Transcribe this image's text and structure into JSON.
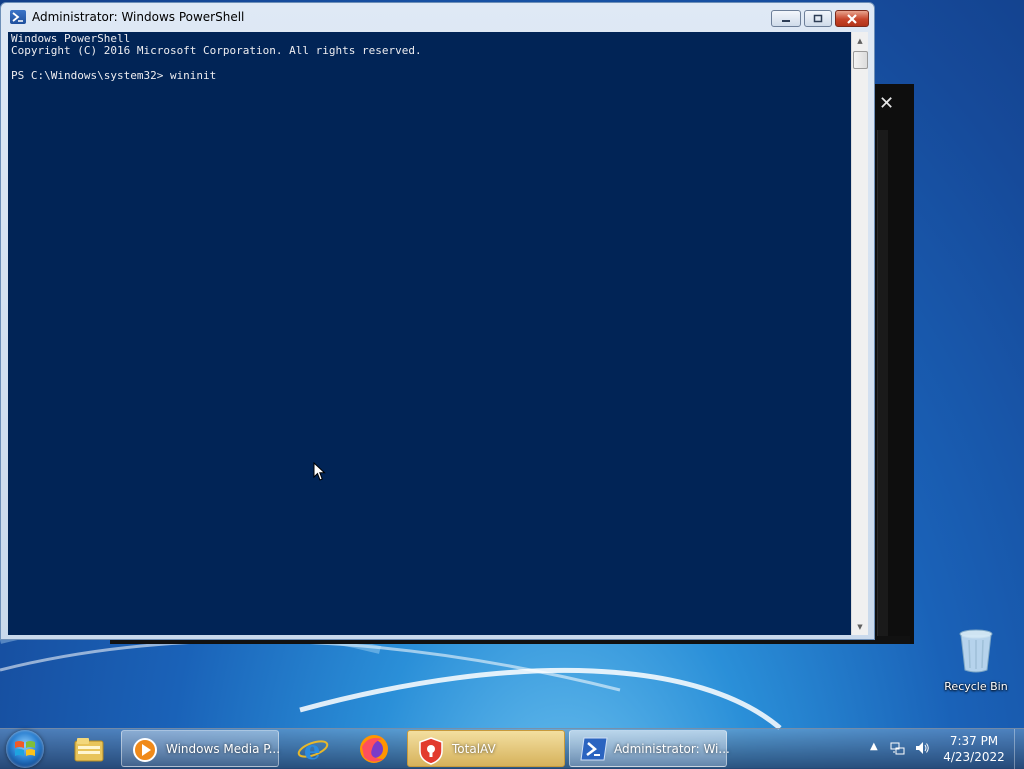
{
  "window": {
    "title": "Administrator: Windows PowerShell",
    "console_lines": [
      "Windows PowerShell",
      "Copyright (C) 2016 Microsoft Corporation. All rights reserved.",
      "",
      "PS C:\\Windows\\system32> wininit"
    ],
    "background_color": "#012456",
    "text_color": "#eeedf0"
  },
  "desktop": {
    "recycle_bin_label": "Recycle Bin"
  },
  "taskbar": {
    "pinned": [
      "file-explorer-icon",
      "internet-explorer-icon",
      "firefox-icon"
    ],
    "buttons": [
      {
        "label": "Windows Media P...",
        "icon": "windows-media-player-icon"
      },
      {
        "label": "TotalAV",
        "icon": "totalav-icon"
      },
      {
        "label": "Administrator: Wi...",
        "icon": "powershell-icon"
      }
    ],
    "clock": {
      "time": "7:37 PM",
      "date": "4/23/2022"
    }
  }
}
